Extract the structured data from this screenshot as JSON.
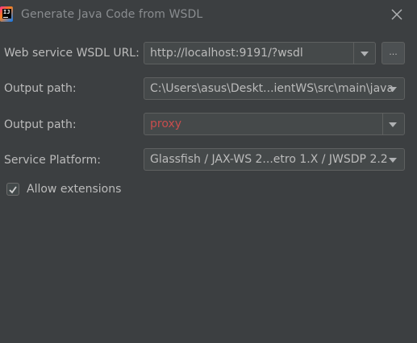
{
  "window": {
    "title": "Generate Java Code from WSDL",
    "app_icon_text": "IJ"
  },
  "form": {
    "wsdl_url": {
      "label": "Web service WSDL URL:",
      "value": "http://localhost:9191/?wsdl",
      "browse_label": "..."
    },
    "output_path": {
      "label": "Output path:",
      "value": "C:\\Users\\asus\\Deskt...ientWS\\src\\main\\java"
    },
    "package_path": {
      "label": "Output path:",
      "value": "proxy",
      "value_color": "#c84d4d"
    },
    "service_platform": {
      "label": "Service Platform:",
      "value": "Glassfish / JAX-WS 2...etro 1.X / JWSDP 2.2"
    },
    "allow_extensions": {
      "label": "Allow extensions",
      "checked": true
    }
  },
  "colors": {
    "background": "#3c3f41",
    "field_background": "#45494a",
    "text": "#bbbbbb",
    "error_text": "#c84d4d"
  },
  "icons": {
    "close": "close-icon",
    "dropdown": "chevron-down-icon",
    "check": "check-icon"
  }
}
